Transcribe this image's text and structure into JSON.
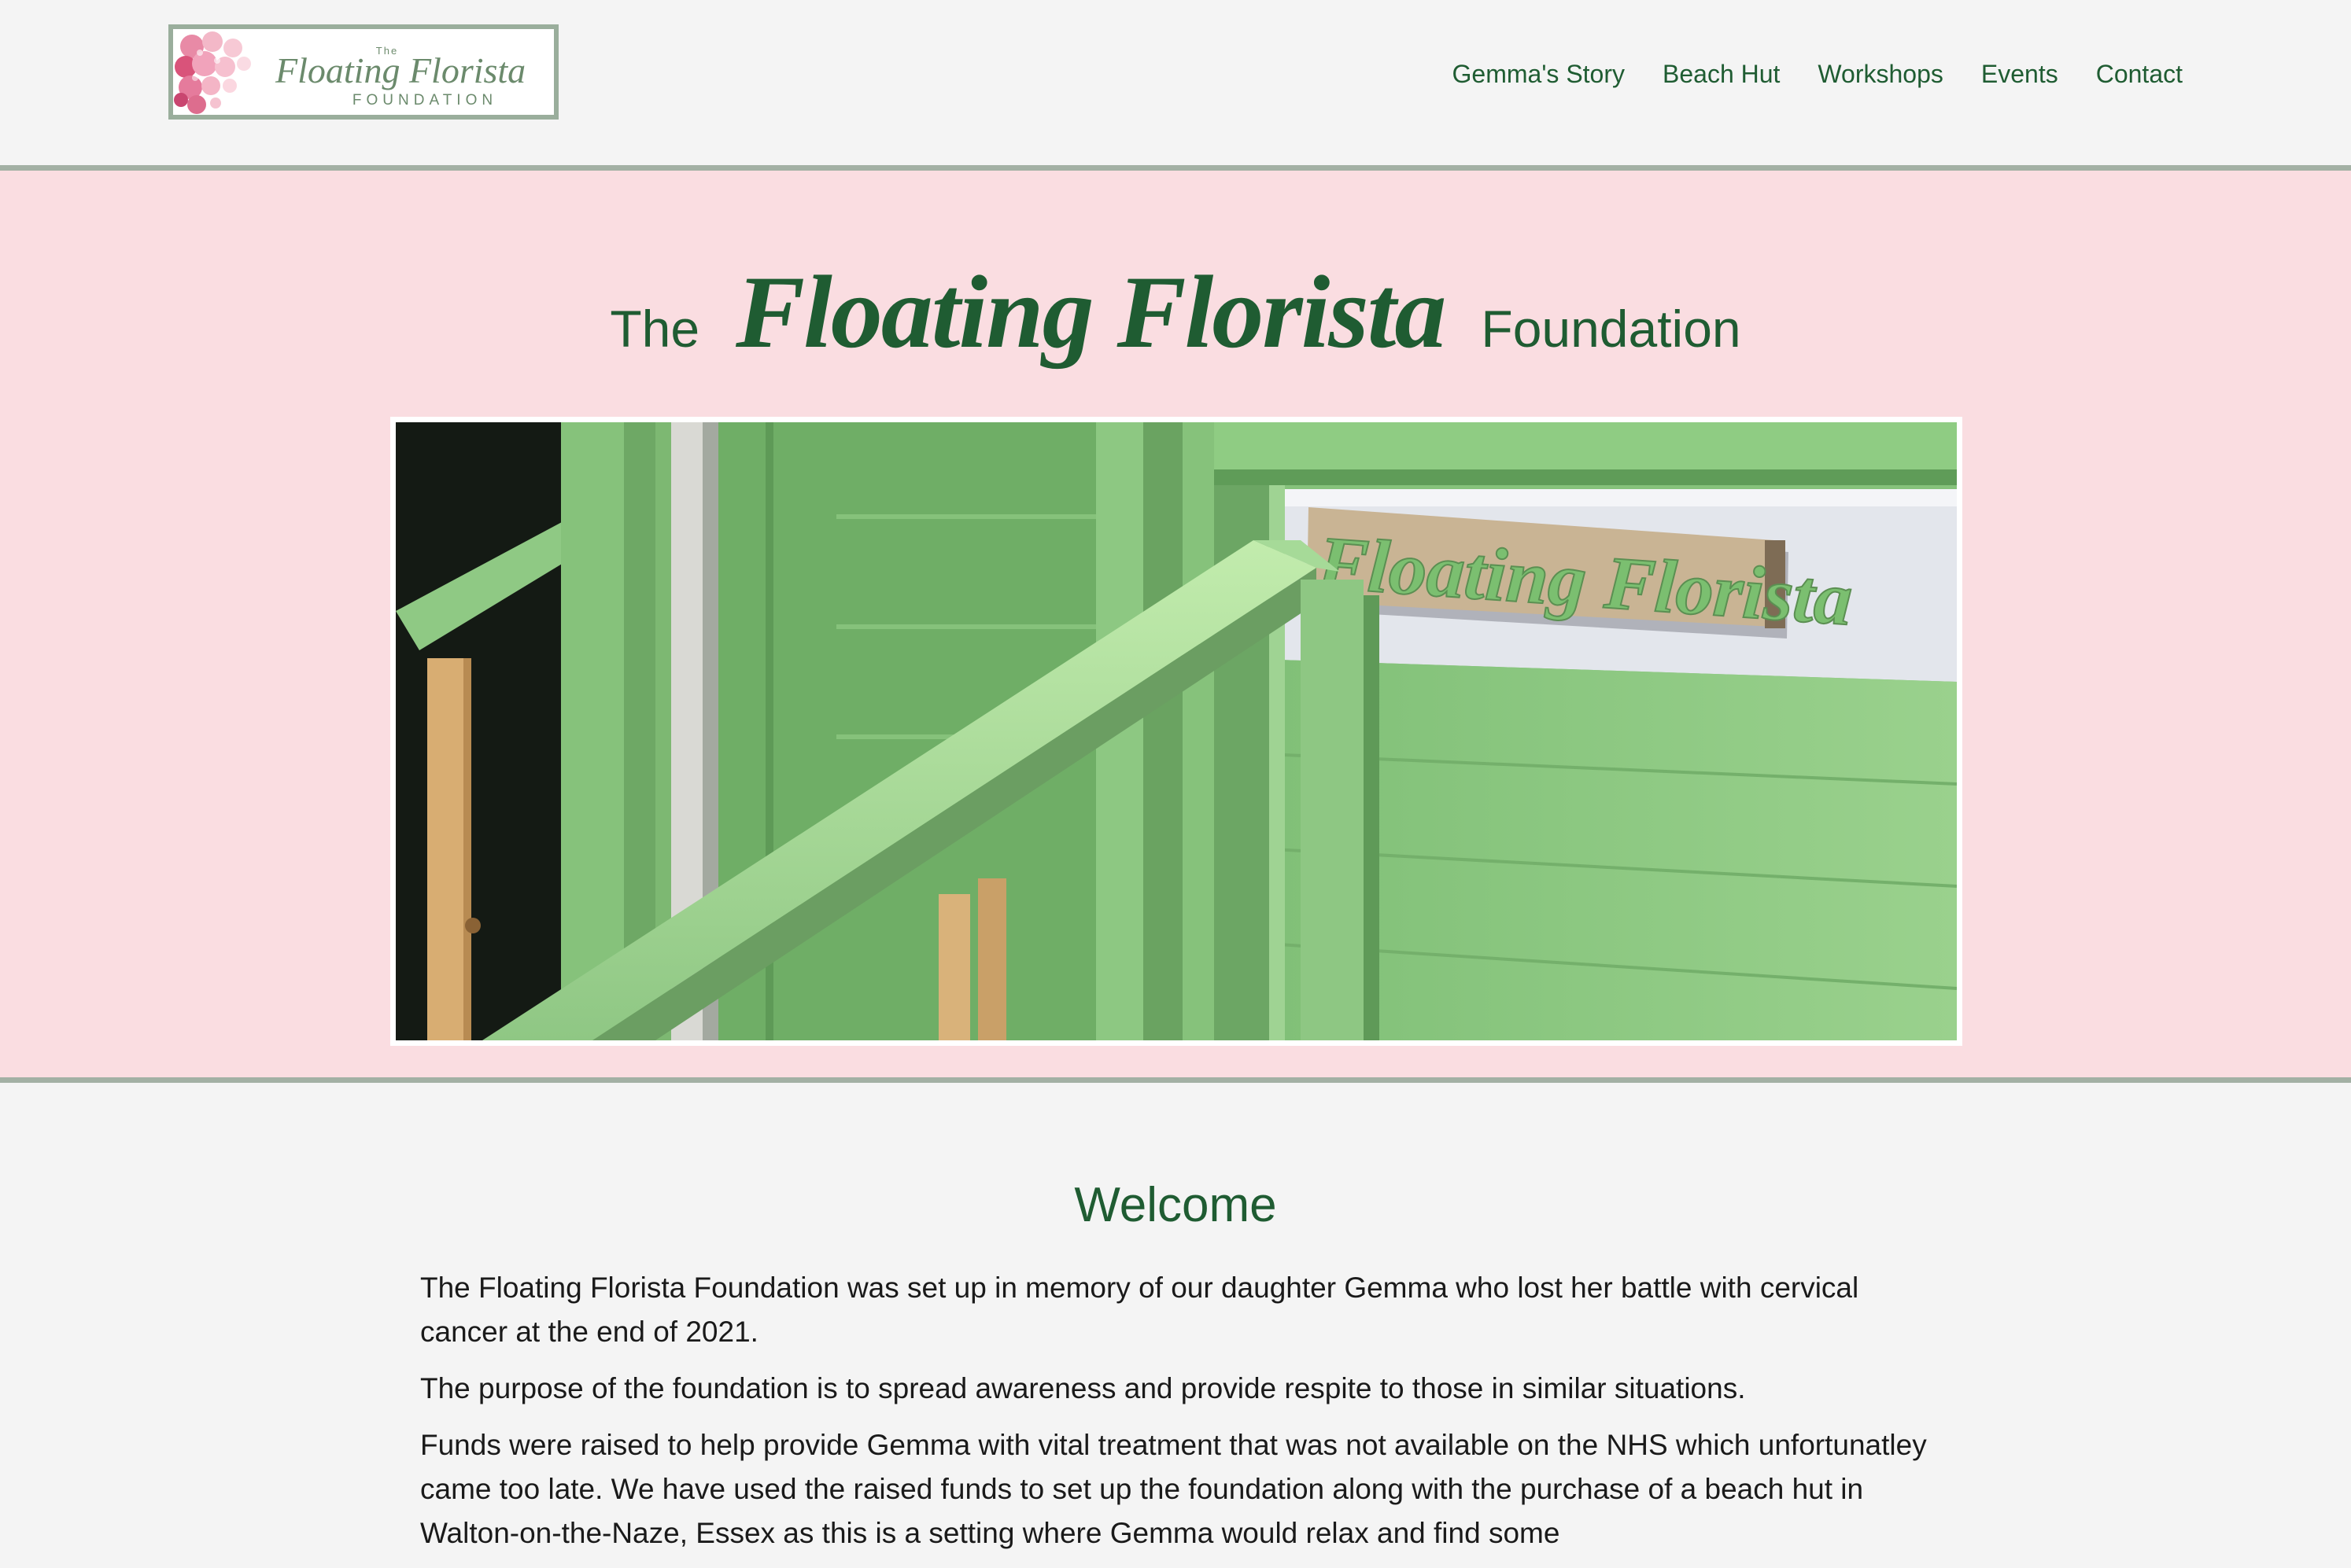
{
  "header": {
    "logo": {
      "the": "The",
      "name": "Floating Florista",
      "foundation": "FOUNDATION"
    },
    "nav": [
      {
        "label": "Gemma's Story"
      },
      {
        "label": "Beach Hut"
      },
      {
        "label": "Workshops"
      },
      {
        "label": "Events"
      },
      {
        "label": "Contact"
      }
    ]
  },
  "hero": {
    "title_prefix": "The",
    "title_script": "Floating Florista",
    "title_suffix": "Foundation",
    "photo_sign_text": "Floating Florista"
  },
  "welcome": {
    "heading": "Welcome",
    "paragraphs": [
      "The Floating Florista Foundation was set up in memory of our daughter Gemma who lost her battle with cervical cancer at the end of 2021.",
      "The purpose of the foundation is to spread awareness and provide respite to those in similar situations.",
      "Funds were raised to help provide Gemma with vital treatment that was not available on the NHS which unfortunatley came too late. We have used the raised funds to set up the foundation along with the purchase of a beach hut in Walton-on-the-Naze, Essex as this is a setting where Gemma would relax and find some"
    ]
  },
  "colors": {
    "brand_green": "#1f5c32",
    "hero_pink": "#fadde1",
    "page_bg": "#f4f4f4",
    "rule_grey_green": "#a3b0a4",
    "logo_border": "#9aae9c"
  }
}
